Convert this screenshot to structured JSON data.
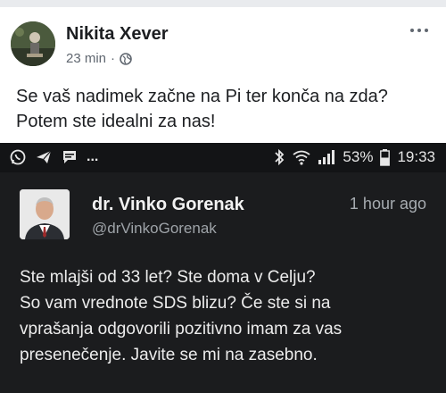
{
  "post": {
    "author": "Nikita Xever",
    "time": "23 min",
    "separator": "·",
    "privacy_icon": "globe-icon",
    "more_icon": "ellipsis-icon",
    "text_lines": [
      "Se vaš nadimek začne na Pi ter konča na zda?",
      "Potem ste idealni za nas!"
    ]
  },
  "screenshot": {
    "status_bar": {
      "left_icons": [
        "whatsapp-icon",
        "send-icon",
        "message-icon"
      ],
      "more": "...",
      "right_icons": [
        "bluetooth-icon",
        "wifi-icon",
        "signal-icon"
      ],
      "battery": "53%",
      "clock": "19:33"
    },
    "tweet": {
      "name": "dr. Vinko Gorenak",
      "handle": "@drVinkoGorenak",
      "time": "1 hour ago",
      "text_lines": [
        "Ste mlajši od 33 let? Ste doma v Celju?",
        "So vam vrednote SDS blizu? Če ste si na",
        "vprašanja odgovorili pozitivno imam za vas",
        "presenečenje.  Javite se mi na zasebno."
      ]
    }
  }
}
